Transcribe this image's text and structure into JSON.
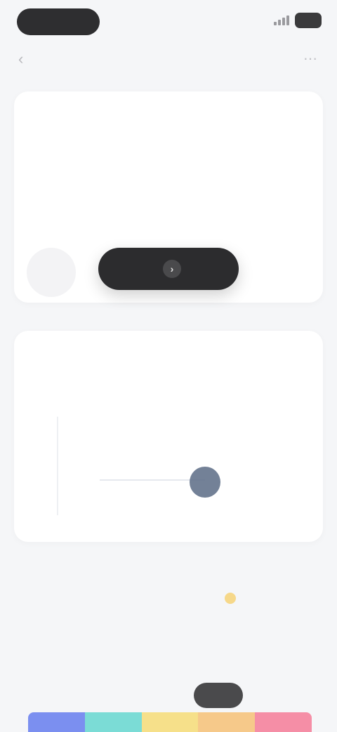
{
  "nav": {
    "title": "",
    "back_icon": "chevron-left-icon",
    "more_icon": "more-icon"
  },
  "summary": {
    "heading": "",
    "big_value": "",
    "left_value": "",
    "left_label": "",
    "right_value": "",
    "right_label": "",
    "button_label": ""
  },
  "chart": {
    "title": "",
    "subtitle": "",
    "caption": "",
    "period_selector": ""
  },
  "chart_data": {
    "type": "scatter",
    "title": "",
    "xlabel": "",
    "ylabel": "",
    "grid": false,
    "series": [
      {
        "x": [
          0.6
        ],
        "y": [
          0.55
        ]
      }
    ],
    "highlight_color": "#5b6b85"
  },
  "metrics": [
    {
      "label": "",
      "value": ""
    },
    {
      "label": "",
      "value": ""
    },
    {
      "label": "",
      "value": ""
    }
  ],
  "legend": {
    "title": "",
    "link": ""
  },
  "color_bar": [
    "#7b8ff0",
    "#7bdcd6",
    "#f6e08a",
    "#f6c98a",
    "#f58ea6"
  ],
  "colors": {
    "background": "#f5f6f8",
    "card": "#ffffff",
    "primary_button": "#2c2c2e"
  }
}
